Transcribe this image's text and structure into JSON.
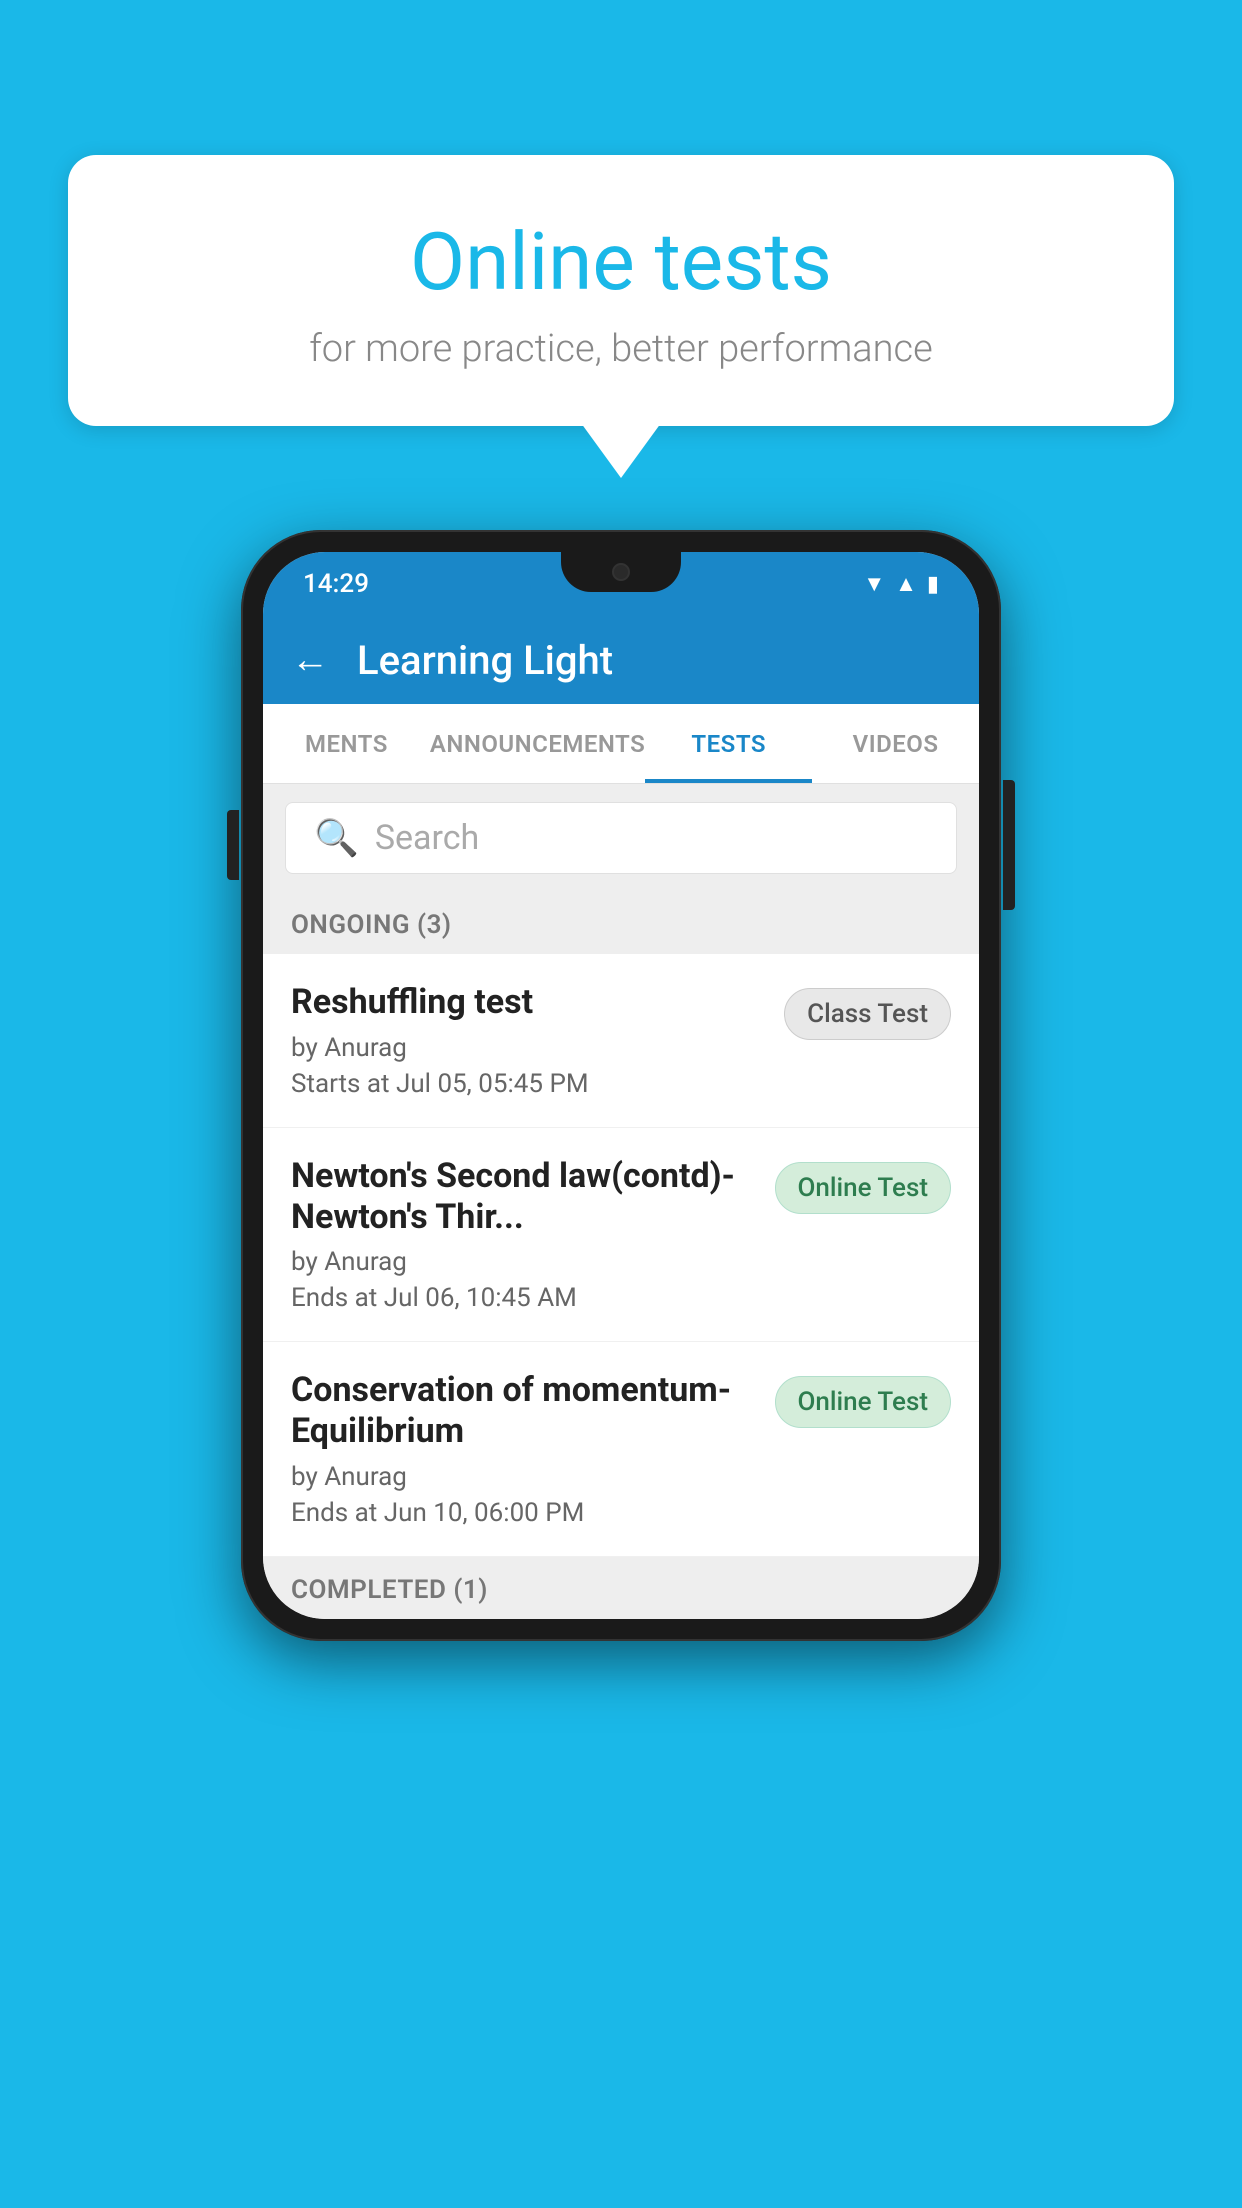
{
  "background_color": "#1ab8e8",
  "promo": {
    "title": "Online tests",
    "subtitle": "for more practice, better performance"
  },
  "status_bar": {
    "time": "14:29",
    "icons": [
      "wifi",
      "signal",
      "battery"
    ]
  },
  "app_header": {
    "back_label": "←",
    "title": "Learning Light"
  },
  "tabs": [
    {
      "id": "ments",
      "label": "MENTS",
      "active": false
    },
    {
      "id": "announcements",
      "label": "ANNOUNCEMENTS",
      "active": false
    },
    {
      "id": "tests",
      "label": "TESTS",
      "active": true
    },
    {
      "id": "videos",
      "label": "VIDEOS",
      "active": false
    }
  ],
  "search": {
    "placeholder": "Search"
  },
  "ongoing_section": {
    "label": "ONGOING (3)",
    "items": [
      {
        "name": "Reshuffling test",
        "author": "by Anurag",
        "date": "Starts at  Jul 05, 05:45 PM",
        "badge": "Class Test",
        "badge_type": "class"
      },
      {
        "name": "Newton's Second law(contd)-Newton's Thir...",
        "author": "by Anurag",
        "date": "Ends at  Jul 06, 10:45 AM",
        "badge": "Online Test",
        "badge_type": "online"
      },
      {
        "name": "Conservation of momentum-Equilibrium",
        "author": "by Anurag",
        "date": "Ends at  Jun 10, 06:00 PM",
        "badge": "Online Test",
        "badge_type": "online"
      }
    ]
  },
  "completed_section": {
    "label": "COMPLETED (1)"
  }
}
